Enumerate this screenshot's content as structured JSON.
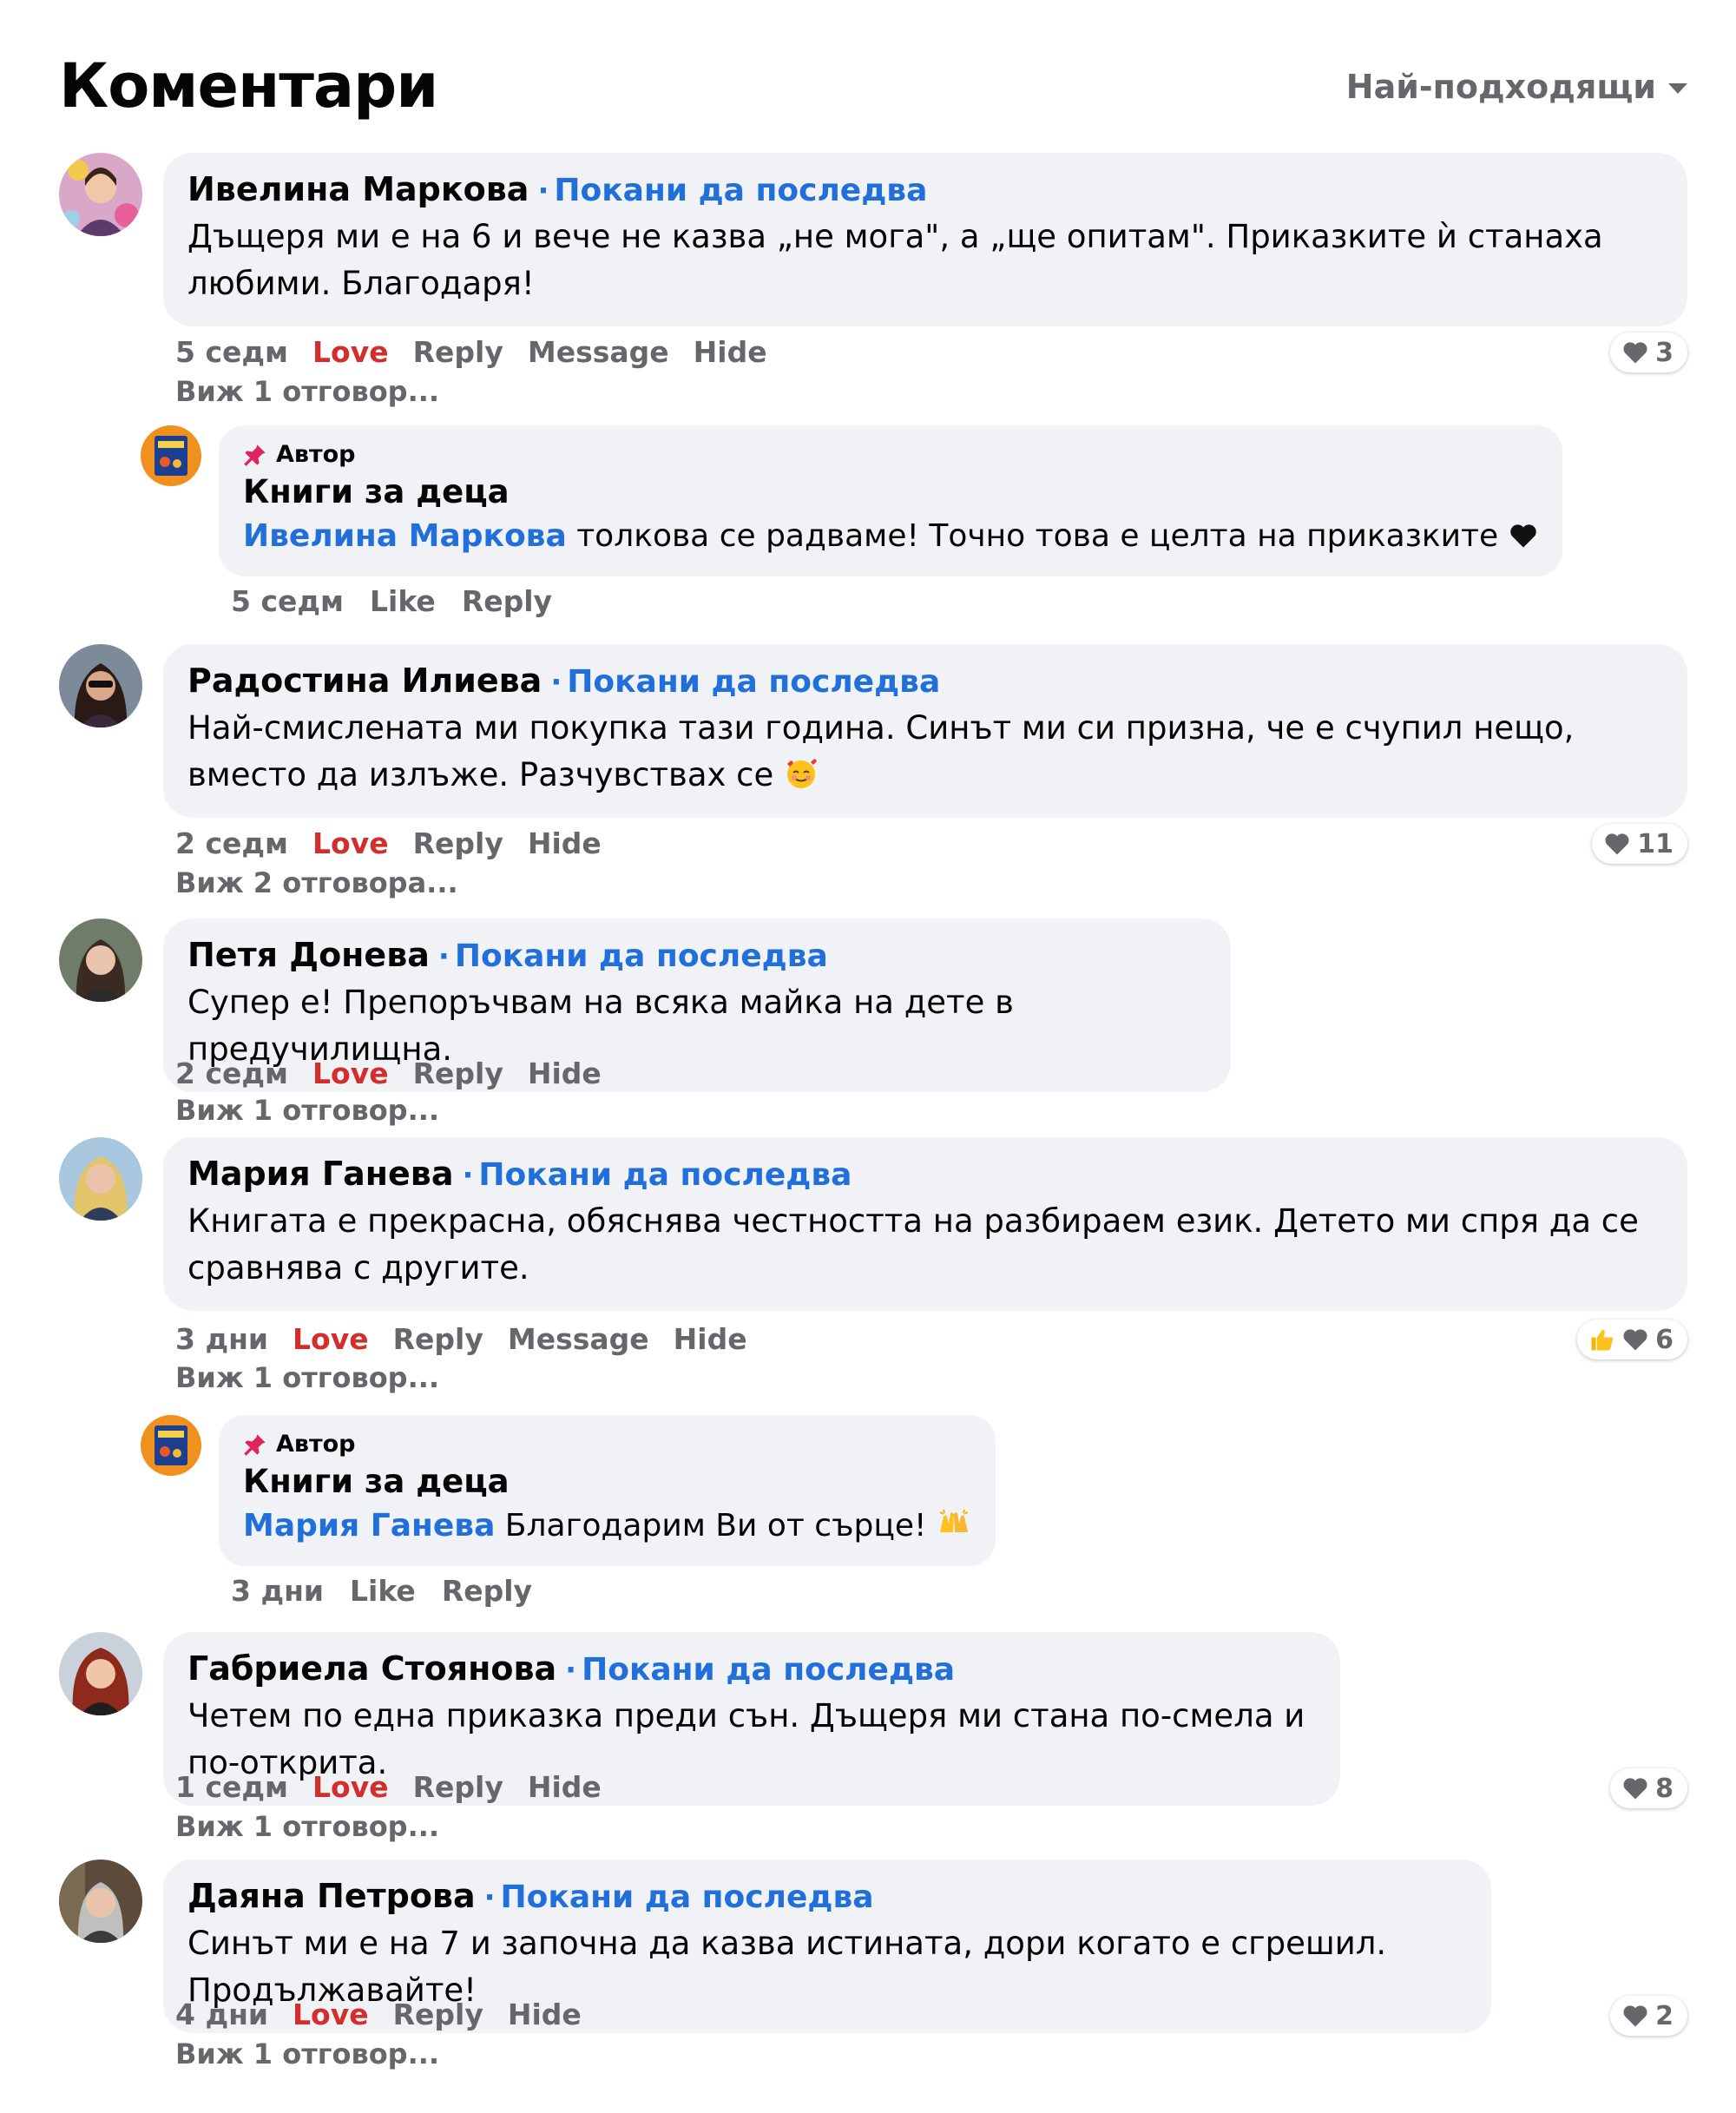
{
  "header": {
    "title": "Коментари",
    "sort_label": "Най-подходящи"
  },
  "colors": {
    "link": "#216fdb",
    "love": "#d32e2e",
    "muted": "#65676b",
    "bubble": "#f0f2f5"
  },
  "invite_label": "Покани да последва",
  "comments": [
    {
      "name": "Ивелина Маркова",
      "text": "Дъщеря ми е на 6 и вече не казва „не мога\", а „ще опитам\". Приказките ѝ станаха любими. Благодаря!",
      "time": "5 седм",
      "love": "Love",
      "reply": "Reply",
      "message": "Message",
      "hide": "Hide",
      "reactions": "3",
      "view_replies": "Виж 1 отговор..."
    },
    {
      "name": "Радостина Илиева",
      "text": "Най-смислената ми покупка тази година. Синът ми си призна, че е счупил нещо, вместо да излъже. Разчувствах се",
      "time": "2 седм",
      "love": "Love",
      "reply": "Reply",
      "hide": "Hide",
      "reactions": "11",
      "view_replies": "Виж 2 отговора..."
    },
    {
      "name": "Петя Донева",
      "text": "Супер е! Препоръчвам на всяка майка на дете в предучилищна.",
      "time": "2 седм",
      "love": "Love",
      "reply": "Reply",
      "hide": "Hide",
      "view_replies": "Виж 1 отговор..."
    },
    {
      "name": "Мария Ганева",
      "text": "Книгата е прекрасна, обяснява честността на разбираем език. Детето ми спря да се сравнява с другите.",
      "time": "3 дни",
      "love": "Love",
      "reply": "Reply",
      "message": "Message",
      "hide": "Hide",
      "reactions": "6",
      "view_replies": "Виж 1 отговор..."
    },
    {
      "name": "Габриела Стоянова",
      "text": "Четем по една приказка преди сън. Дъщеря ми стана по-смела и по-открита.",
      "time": "1 седм",
      "love": "Love",
      "reply": "Reply",
      "hide": "Hide",
      "reactions": "8",
      "view_replies": "Виж 1 отговор..."
    },
    {
      "name": "Даяна Петрова",
      "text": "Синът ми е на 7 и започна да казва истината, дори когато е сгрешил. Продължавайте!",
      "time": "4 дни",
      "love": "Love",
      "reply": "Reply",
      "hide": "Hide",
      "reactions": "2",
      "view_replies": "Виж 1 отговор..."
    }
  ],
  "replies": [
    {
      "badge": "Автор",
      "name": "Книги за деца",
      "mention": "Ивелина Маркова",
      "text": " толкова се радваме! Точно това е целта на приказките",
      "time": "5 седм",
      "like": "Like",
      "reply": "Reply"
    },
    {
      "badge": "Автор",
      "name": "Книги за деца",
      "mention": "Мария Ганева",
      "text": " Благодарим Ви от сърце!",
      "time": "3 дни",
      "like": "Like",
      "reply": "Reply"
    }
  ]
}
